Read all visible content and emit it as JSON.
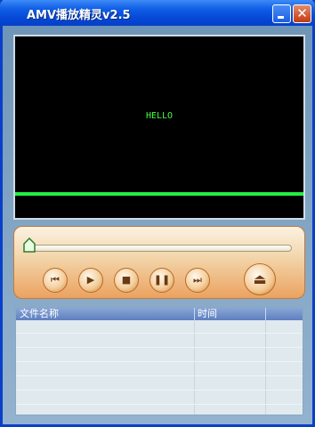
{
  "window": {
    "title": "AMV播放精灵v2.5"
  },
  "video": {
    "text": "HELLO"
  },
  "controls": {
    "progress_fraction": 0.0,
    "buttons": [
      {
        "name": "previous",
        "glyph": "⏮"
      },
      {
        "name": "play",
        "glyph": "▶"
      },
      {
        "name": "stop",
        "glyph": "■"
      },
      {
        "name": "pause",
        "glyph": "❚❚"
      },
      {
        "name": "next",
        "glyph": "⏭"
      },
      {
        "name": "eject",
        "glyph": "⏏"
      }
    ]
  },
  "playlist": {
    "columns": [
      "文件名称",
      "时间",
      ""
    ],
    "rows": []
  },
  "colors": {
    "titlebar": "#0648d6",
    "video_text": "#42ff42",
    "panel_accent": "#eba260"
  }
}
